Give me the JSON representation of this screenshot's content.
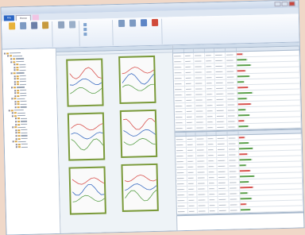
{
  "window": {
    "title": ""
  },
  "tabs": [
    {
      "label": "File",
      "kind": "file"
    },
    {
      "label": "Home",
      "kind": "active"
    },
    {
      "label": "",
      "kind": "ctx"
    },
    {
      "label": "",
      "kind": ""
    }
  ],
  "ribbon": {
    "groups": [
      {
        "label": "",
        "buttons": [
          {
            "label": "",
            "icon": "open-icon",
            "color": "#e8b23a"
          },
          {
            "label": "",
            "icon": "folder-icon",
            "color": "#7d9ac2"
          },
          {
            "label": "",
            "icon": "save-icon",
            "color": "#6b7fa8"
          },
          {
            "label": "",
            "icon": "export-icon",
            "color": "#c79a3e"
          }
        ]
      },
      {
        "label": "",
        "buttons": [
          {
            "label": "",
            "icon": "undo-icon",
            "color": "#8fa3bf"
          },
          {
            "label": "",
            "icon": "grid-icon",
            "color": "#9aafc9"
          }
        ]
      },
      {
        "label": "",
        "small": [
          {
            "label": "",
            "icon": "check-icon"
          },
          {
            "label": "",
            "icon": "check-icon"
          },
          {
            "label": "",
            "icon": "check-icon"
          }
        ]
      },
      {
        "label": "",
        "buttons": [
          {
            "label": "",
            "icon": "chart-icon",
            "color": "#7d9ac2"
          },
          {
            "label": "",
            "icon": "report-icon",
            "color": "#7d9ac2"
          },
          {
            "label": "",
            "icon": "table-icon",
            "color": "#5c85c6"
          },
          {
            "label": "",
            "icon": "delete-icon",
            "color": "#d04a3a"
          }
        ]
      }
    ]
  },
  "center_panel": {
    "title": "",
    "subtitle": ""
  },
  "thumbnails": [
    {
      "title": ""
    },
    {
      "title": ""
    },
    {
      "title": ""
    },
    {
      "title": ""
    },
    {
      "title": ""
    },
    {
      "title": ""
    }
  ],
  "grid_top": {
    "title": "",
    "columns": [
      "",
      "",
      "",
      "",
      "",
      "",
      ""
    ]
  },
  "grid_bottom": {
    "columns": [
      "",
      "",
      "",
      "",
      "",
      "",
      ""
    ]
  },
  "colors": {
    "accent": "#7a9a3a",
    "ribbon": "#e4ecf7",
    "file_tab": "#2b66c4"
  }
}
